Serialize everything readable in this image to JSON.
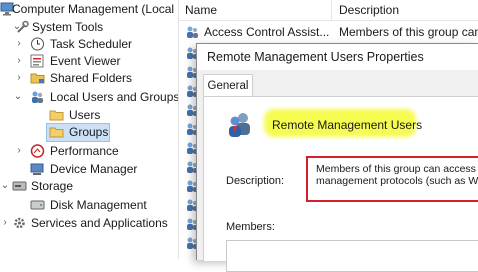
{
  "tree": {
    "root_label": "Computer Management (Local",
    "system_tools": "System Tools",
    "task_scheduler": "Task Scheduler",
    "event_viewer": "Event Viewer",
    "shared_folders": "Shared Folders",
    "local_users_groups": "Local Users and Groups",
    "users": "Users",
    "groups": "Groups",
    "performance": "Performance",
    "device_manager": "Device Manager",
    "storage": "Storage",
    "disk_management": "Disk Management",
    "services_apps": "Services and Applications"
  },
  "list": {
    "col_name": "Name",
    "col_description": "Description",
    "row0_name": "Access Control Assist...",
    "row0_desc": "Members of this group can"
  },
  "dialog": {
    "title": "Remote Management Users Properties",
    "tab_general": "General",
    "group_name": "Remote Management Users",
    "description_label": "Description:",
    "description_text": "Members of this group can access W\nmanagement protocols (such as WS",
    "members_label": "Members:",
    "highlight_color": "#f4fb3c",
    "callout_color": "#d62027"
  }
}
